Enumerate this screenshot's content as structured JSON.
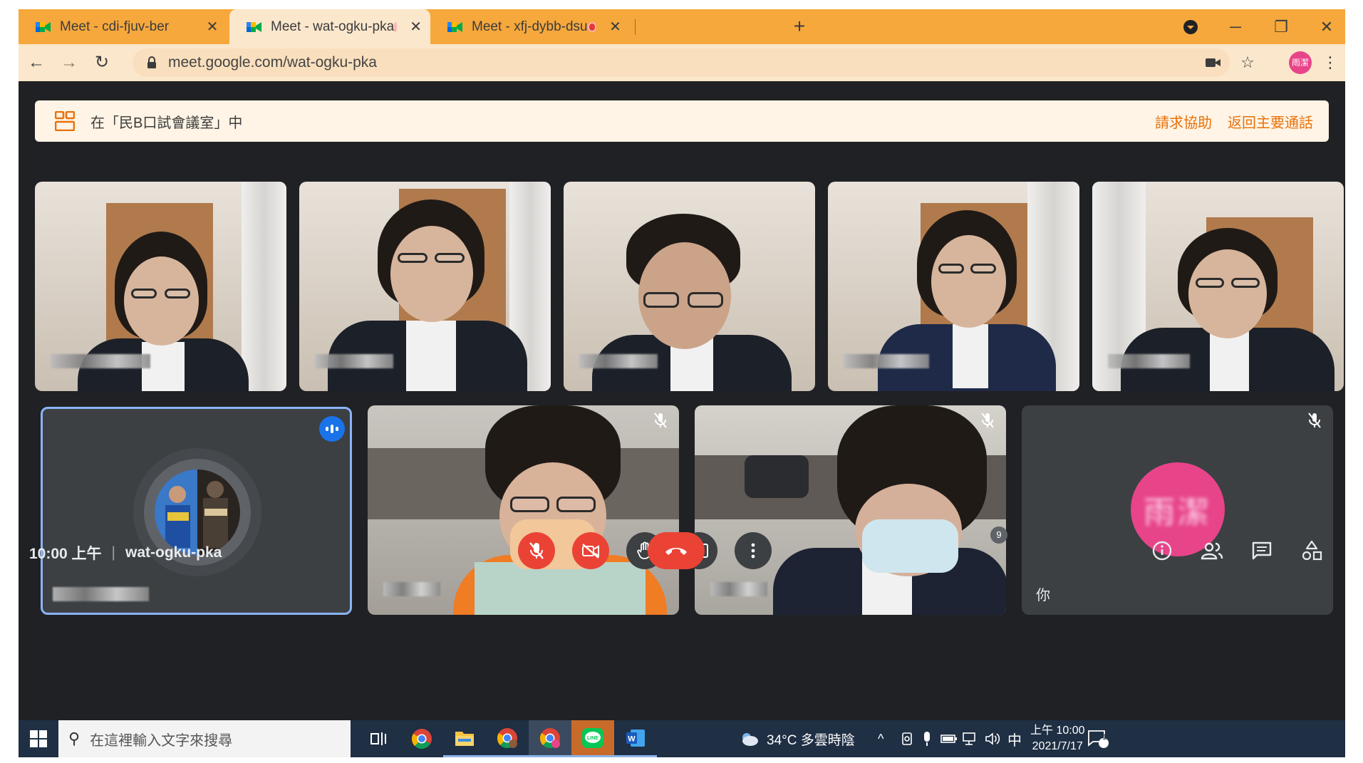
{
  "browser": {
    "tabs": [
      {
        "title": "Meet - cdi-fjuv-ber",
        "recording": false,
        "active": false
      },
      {
        "title": "Meet - wat-ogku-pka",
        "recording": true,
        "active": true
      },
      {
        "title": "Meet - xfj-dybb-dsu",
        "recording": true,
        "active": false
      }
    ],
    "new_tab_glyph": "+",
    "url": "meet.google.com/wat-ogku-pka",
    "profile_initials": "雨潔"
  },
  "breakout_banner": {
    "text": "在「民B口試會議室」中",
    "request_help": "請求協助",
    "return_main": "返回主要通話"
  },
  "tiles": {
    "self_label": "你",
    "self_initials": "雨潔"
  },
  "meeting": {
    "time": "10:00 上午",
    "separator": "|",
    "code": "wat-ogku-pka",
    "participant_count": "9"
  },
  "taskbar": {
    "search_placeholder": "在這裡輸入文字來搜尋",
    "weather": "34°C 多雲時陰",
    "ime": "中",
    "clock_time": "上午 10:00",
    "clock_date": "2021/7/17",
    "notification_count": "1"
  },
  "icons": {
    "mic_off": "mic-off-icon",
    "cam_off": "camera-off-icon",
    "raise_hand": "raise-hand-icon",
    "present": "present-screen-icon",
    "more": "more-options-icon",
    "hangup": "hangup-icon",
    "info": "meeting-info-icon",
    "people": "people-icon",
    "chat": "chat-icon",
    "activities": "activities-icon"
  },
  "colors": {
    "tab_strip": "#f6a83c",
    "meet_bg": "#202124",
    "danger": "#ea4335",
    "accent_orange": "#e8710a",
    "speaking_border": "#8ab4f8",
    "avatar_pink": "#e8448a"
  }
}
